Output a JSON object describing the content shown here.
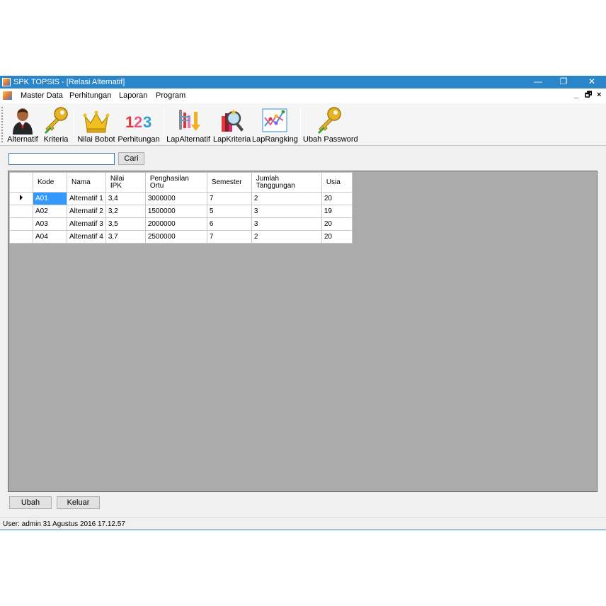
{
  "window": {
    "title": "SPK TOPSIS - [Relasi Alternatif]",
    "controls": {
      "minimize": "—",
      "maximize": "❐",
      "close": "✕"
    }
  },
  "menu": {
    "items": [
      "Master Data",
      "Perhitungan",
      "Laporan",
      "Program"
    ],
    "mdi_controls": [
      "_",
      "🗗",
      "×"
    ]
  },
  "toolbar": {
    "buttons": [
      {
        "label": "Alternatif",
        "icon": "person-icon"
      },
      {
        "label": "Kriteria",
        "icon": "key-icon"
      },
      {
        "label": "Nilai Bobot",
        "icon": "crown-icon"
      },
      {
        "label": "Perhitungan",
        "icon": "numbers-123-icon"
      },
      {
        "label": "LapAlternatif",
        "icon": "sort-report-icon"
      },
      {
        "label": "LapKriteria",
        "icon": "magnifier-report-icon"
      },
      {
        "label": "LapRangking",
        "icon": "ranking-chart-icon"
      },
      {
        "label": "Ubah Password",
        "icon": "key-password-icon"
      }
    ]
  },
  "search": {
    "value": "",
    "placeholder": "",
    "button_label": "Cari"
  },
  "grid": {
    "headers": [
      "Kode",
      "Nama",
      "Nilai\nIPK",
      "Penghasilan\nOrtu",
      "Semester",
      "Jumlah\nTanggungan",
      "Usia"
    ],
    "rows": [
      [
        "A01",
        "Alternatif 1",
        "3,4",
        "3000000",
        "7",
        "2",
        "20"
      ],
      [
        "A02",
        "Alternatif 2",
        "3,2",
        "1500000",
        "5",
        "3",
        "19"
      ],
      [
        "A03",
        "Alternatif 3",
        "3,5",
        "2000000",
        "6",
        "3",
        "20"
      ],
      [
        "A04",
        "Alternatif 4",
        "3,7",
        "2500000",
        "7",
        "2",
        "20"
      ]
    ],
    "selected_row": 0
  },
  "actions": {
    "edit_label": "Ubah",
    "exit_label": "Keluar"
  },
  "status": {
    "text": "User: admin  31 Agustus 2016 17.12.57"
  },
  "colors": {
    "titlebar": "#2b85c9",
    "selection": "#3399ff",
    "grid_background": "#ababab"
  }
}
